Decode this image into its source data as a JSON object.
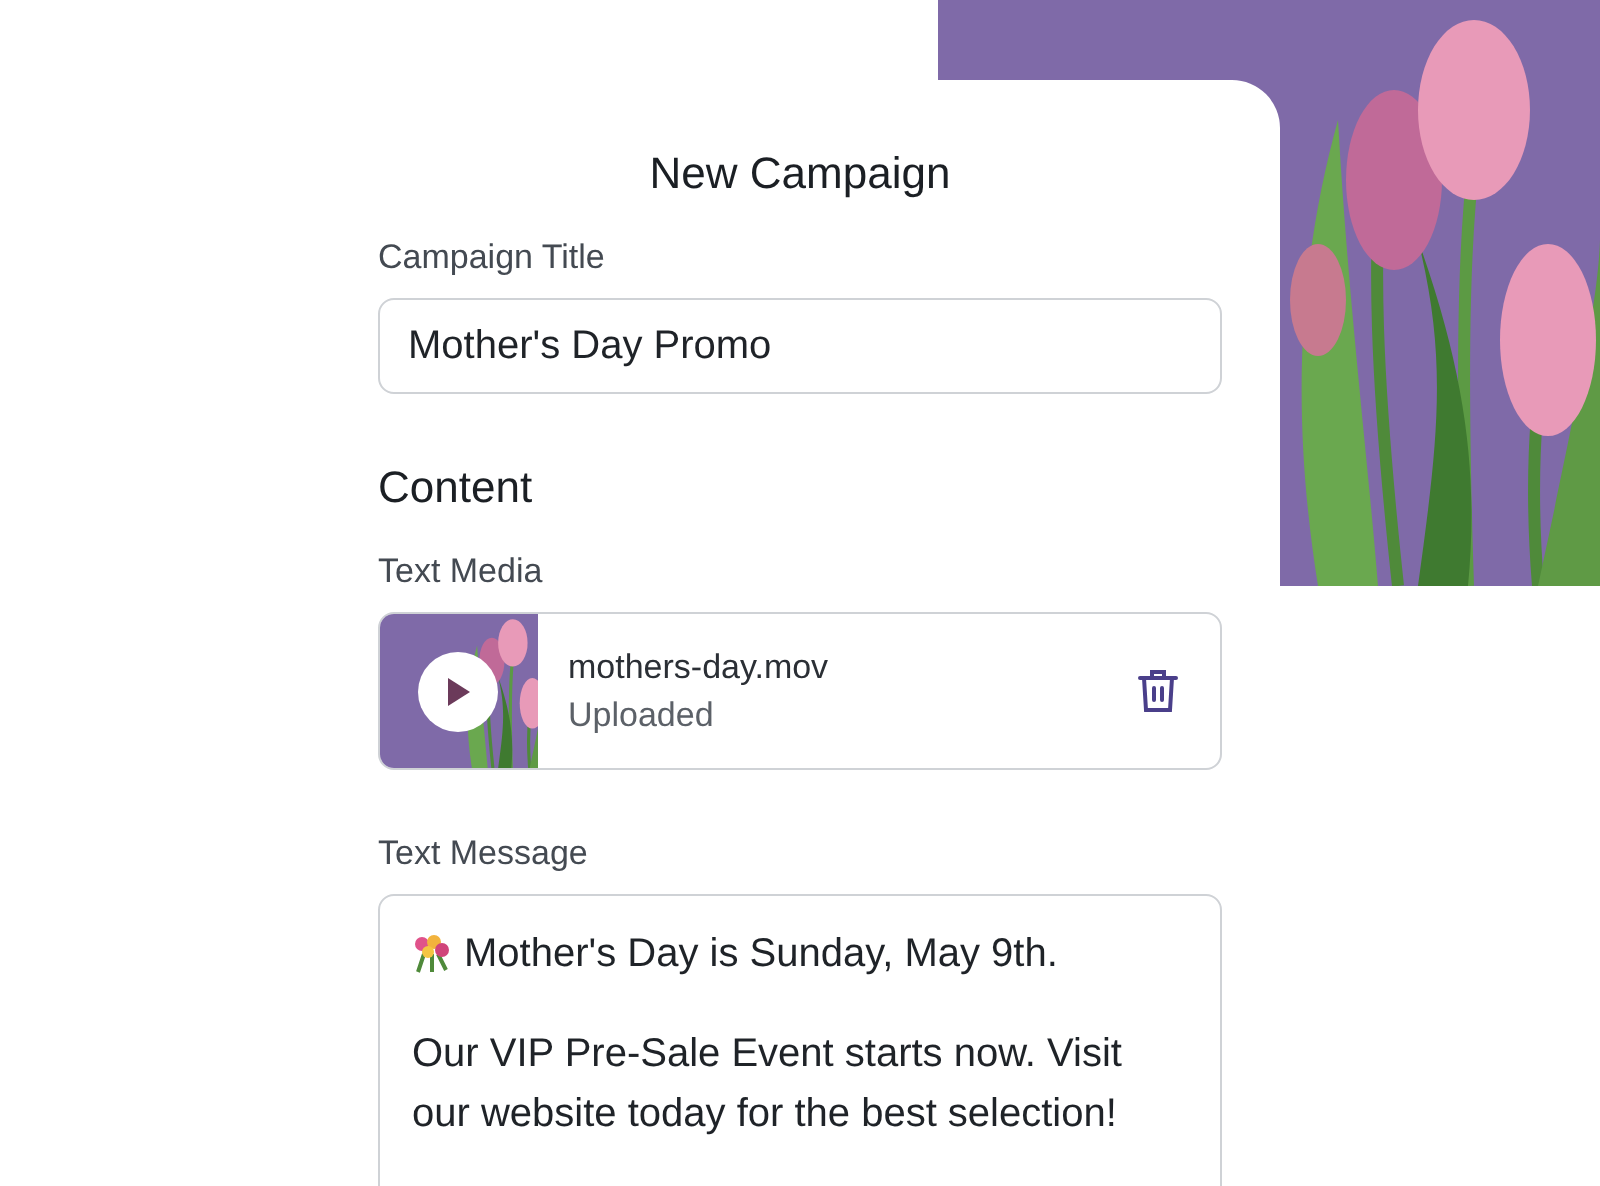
{
  "form": {
    "title": "New Campaign",
    "campaign_title": {
      "label": "Campaign Title",
      "value": "Mother's Day Promo"
    },
    "section": "Content",
    "text_media": {
      "label": "Text Media",
      "file_name": "mothers-day.mov",
      "status": "Uploaded"
    },
    "text_message": {
      "label": "Text Message",
      "paragraphs": [
        "Mother's Day is Sunday, May 9th.",
        "Our VIP Pre-Sale Event starts now. Visit our website today for the best selection!"
      ]
    }
  }
}
